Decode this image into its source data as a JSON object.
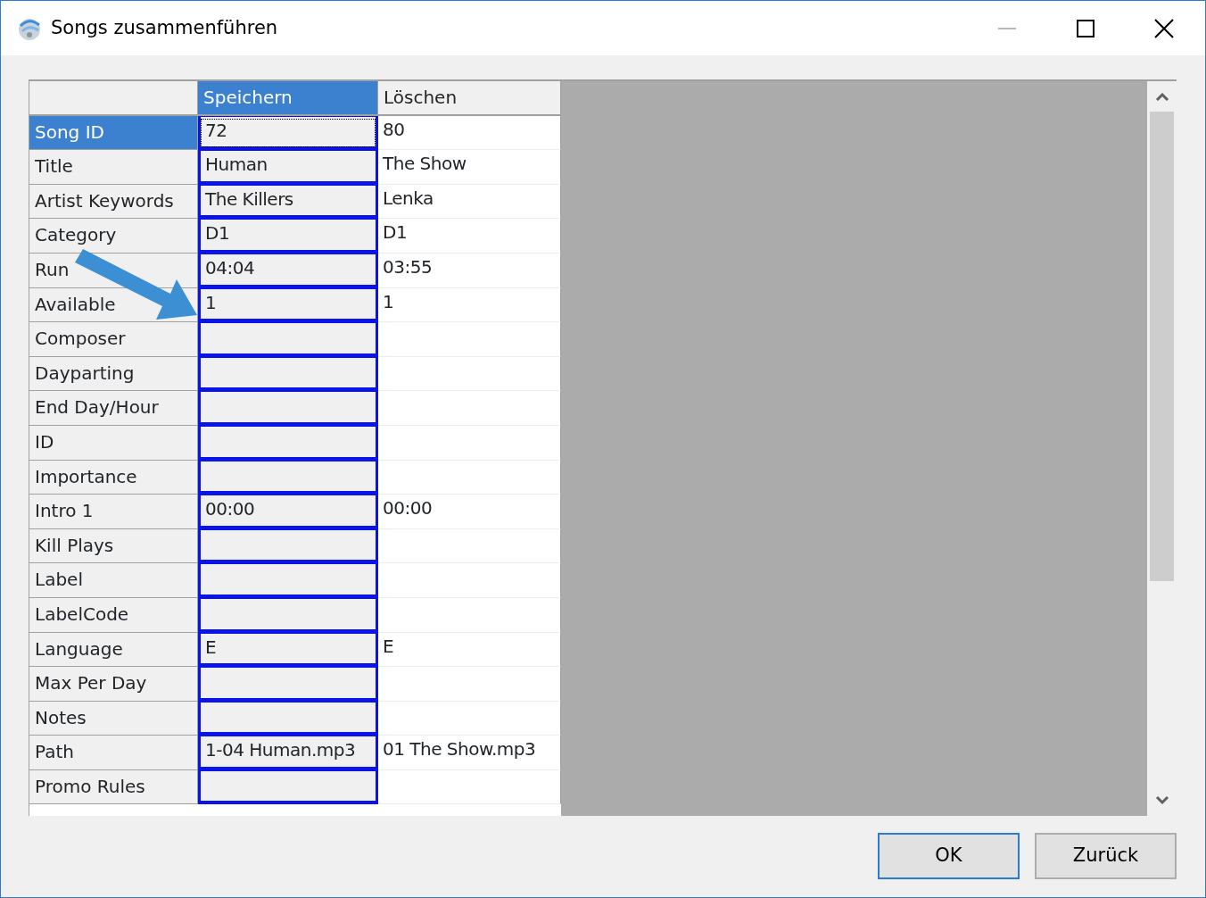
{
  "window": {
    "title": "Songs zusammenführen"
  },
  "table": {
    "columns": [
      {
        "label": "Speichern",
        "selected": true
      },
      {
        "label": "Löschen",
        "selected": false
      }
    ],
    "rows": [
      {
        "field": "Song ID",
        "selected": true,
        "cells": [
          {
            "text": "72",
            "focused": true
          },
          {
            "text": "80",
            "focused": false
          }
        ]
      },
      {
        "field": "Title",
        "selected": false,
        "cells": [
          {
            "text": "Human",
            "focused": false
          },
          {
            "text": "The Show",
            "focused": false
          }
        ]
      },
      {
        "field": "Artist Keywords",
        "selected": false,
        "cells": [
          {
            "text": "The Killers",
            "focused": false
          },
          {
            "text": "Lenka",
            "focused": false
          }
        ]
      },
      {
        "field": "Category",
        "selected": false,
        "cells": [
          {
            "text": "D1",
            "focused": false
          },
          {
            "text": "D1",
            "focused": false
          }
        ]
      },
      {
        "field": "Run",
        "selected": false,
        "cells": [
          {
            "text": "04:04",
            "focused": false
          },
          {
            "text": "03:55",
            "focused": false
          }
        ]
      },
      {
        "field": "Available",
        "selected": false,
        "cells": [
          {
            "text": "1",
            "focused": false
          },
          {
            "text": "1",
            "focused": false
          }
        ]
      },
      {
        "field": "Composer",
        "selected": false,
        "cells": [
          {
            "focused": false
          },
          {
            "focused": false
          }
        ]
      },
      {
        "field": "Dayparting",
        "selected": false,
        "cells": [
          {
            "focused": false
          },
          {
            "focused": false
          }
        ]
      },
      {
        "field": "End Day/Hour",
        "selected": false,
        "cells": [
          {
            "focused": false
          },
          {
            "focused": false
          }
        ]
      },
      {
        "field": "ID",
        "selected": false,
        "cells": [
          {
            "focused": false
          },
          {
            "focused": false
          }
        ]
      },
      {
        "field": "Importance",
        "selected": false,
        "cells": [
          {
            "focused": false
          },
          {
            "focused": false
          }
        ]
      },
      {
        "field": "Intro 1",
        "selected": false,
        "cells": [
          {
            "text": "00:00",
            "focused": false
          },
          {
            "text": "00:00",
            "focused": false
          }
        ]
      },
      {
        "field": "Kill Plays",
        "selected": false,
        "cells": [
          {
            "focused": false
          },
          {
            "focused": false
          }
        ]
      },
      {
        "field": "Label",
        "selected": false,
        "cells": [
          {
            "focused": false
          },
          {
            "focused": false
          }
        ]
      },
      {
        "field": "LabelCode",
        "selected": false,
        "cells": [
          {
            "focused": false
          },
          {
            "focused": false
          }
        ]
      },
      {
        "field": "Language",
        "selected": false,
        "cells": [
          {
            "text": "E",
            "focused": false
          },
          {
            "text": "E",
            "focused": false
          }
        ]
      },
      {
        "field": "Max Per Day",
        "selected": false,
        "cells": [
          {
            "focused": false
          },
          {
            "focused": false
          }
        ]
      },
      {
        "field": "Notes",
        "selected": false,
        "cells": [
          {
            "focused": false
          },
          {
            "focused": false
          }
        ]
      },
      {
        "field": "Path",
        "selected": false,
        "cells": [
          {
            "text": "1-04 Human.mp3",
            "focused": false
          },
          {
            "text": "01 The Show.mp3",
            "focused": false
          }
        ]
      },
      {
        "field": "Promo Rules",
        "selected": false,
        "cells": [
          {
            "focused": false
          },
          {
            "focused": false
          }
        ]
      }
    ]
  },
  "buttons": [
    {
      "label": "OK",
      "default": true
    },
    {
      "label": "Zurück",
      "default": false
    }
  ]
}
